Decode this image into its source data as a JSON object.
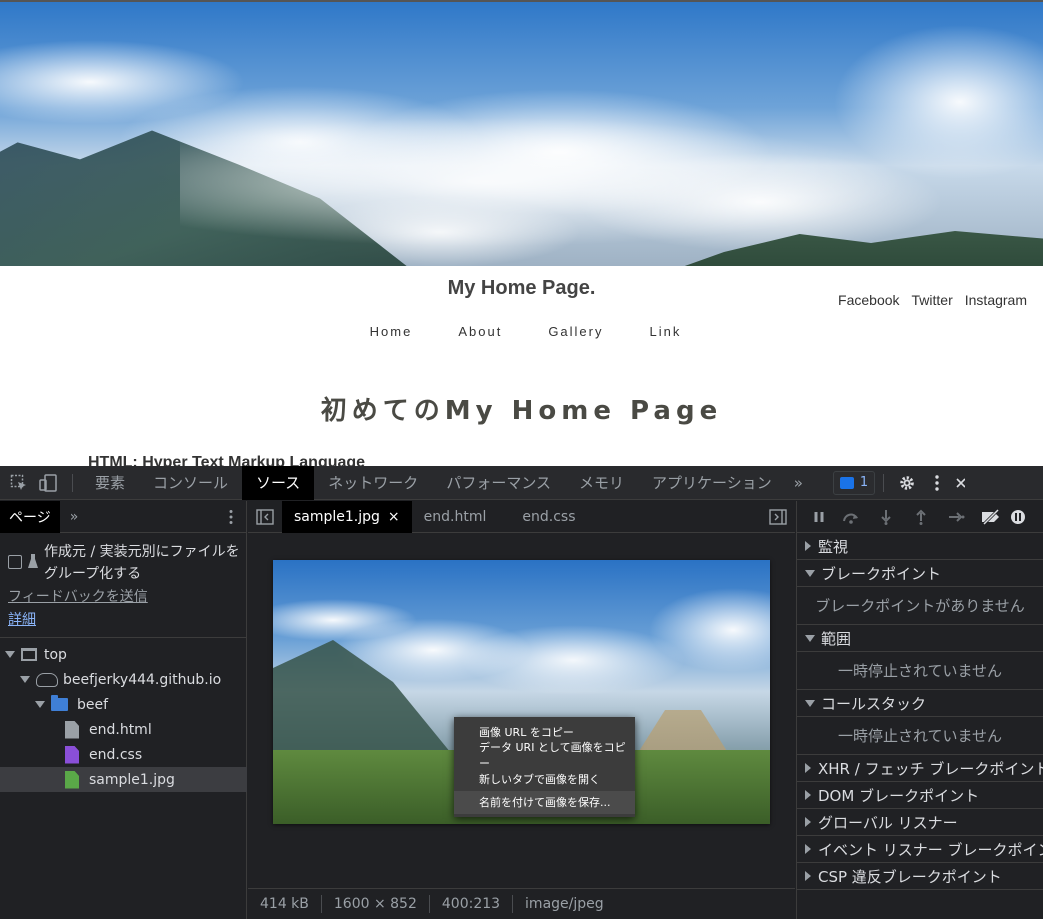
{
  "site": {
    "title": "My Home Page.",
    "social": [
      "Facebook",
      "Twitter",
      "Instagram"
    ],
    "nav": [
      "Home",
      "About",
      "Gallery",
      "Link"
    ],
    "heading": "初めてのMy Home Page",
    "subheading": "HTML: Hyper Text Markup Language"
  },
  "devtools": {
    "tabs": [
      "要素",
      "コンソール",
      "ソース",
      "ネットワーク",
      "パフォーマンス",
      "メモリ",
      "アプリケーション"
    ],
    "more_tabs": "»",
    "issues_count": "1",
    "navigator": {
      "tab": "ページ",
      "more": "»",
      "group_label": "作成元 / 実装元別にファイルをグループ化する",
      "feedback_link": "フィードバックを送信",
      "details_link": "詳細",
      "tree": {
        "top": "top",
        "domain": "beefjerky444.github.io",
        "folder": "beef",
        "files": [
          "end.html",
          "end.css",
          "sample1.jpg"
        ]
      }
    },
    "editor": {
      "tabs": [
        "sample1.jpg",
        "end.html",
        "end.css"
      ],
      "close_glyph": "×",
      "context_menu": [
        "画像 URL をコピー",
        "データ URI として画像をコピー",
        "新しいタブで画像を開く",
        "名前を付けて画像を保存..."
      ],
      "status": {
        "size": "414 kB",
        "dimensions": "1600 × 852",
        "coords": "400:213",
        "mime": "image/jpeg"
      }
    },
    "debugger": {
      "sections": {
        "watch": "監視",
        "breakpoints": "ブレークポイント",
        "no_breakpoints": "ブレークポイントがありません",
        "scope": "範囲",
        "not_paused": "一時停止されていません",
        "call_stack": "コールスタック",
        "not_paused_2": "一時停止されていません",
        "xhr": "XHR / フェッチ ブレークポイント",
        "dom": "DOM ブレークポイント",
        "global": "グローバル リスナー",
        "event": "イベント リスナー ブレークポイント",
        "csp": "CSP 違反ブレークポイント"
      }
    }
  },
  "colors": {
    "devtools_bg": "#202124",
    "toolbar_bg": "#292a2d",
    "accent_blue": "#8ab4f8",
    "folder_blue": "#3f7fd6",
    "file_html": "#9aa0a6",
    "file_css": "#8a4fd8",
    "file_image": "#5aa848"
  },
  "icons": {
    "inspect": "inspect-cursor-icon",
    "device": "device-toolbar-icon",
    "settings": "gear-icon",
    "menu": "kebab-menu-icon"
  }
}
